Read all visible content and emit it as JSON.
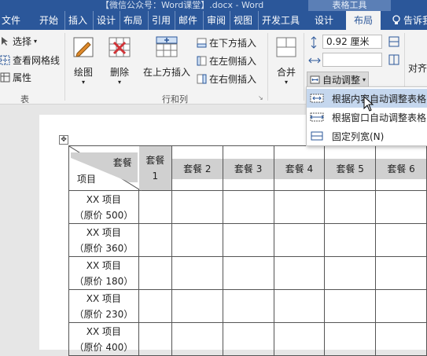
{
  "titlebar": {
    "document": "【微信公众号：Word课堂】.docx - Word",
    "table_tools": "表格工具"
  },
  "tabs": [
    "文件",
    "开始",
    "插入",
    "设计",
    "布局",
    "引用",
    "邮件",
    "审阅",
    "视图",
    "开发工具",
    "设计",
    "布局"
  ],
  "tell_me": "告诉我",
  "ribbon": {
    "select": "选择",
    "view_gridlines": "查看网格线",
    "properties": "属性",
    "group_table": "表",
    "draw": "绘图",
    "delete": "删除",
    "insert_above": "在上方插入",
    "insert_below": "在下方插入",
    "insert_left": "在左侧插入",
    "insert_right": "在右侧插入",
    "group_rows_cols": "行和列",
    "merge": "合并",
    "row_height": "0.92 厘米",
    "autofit": "自动调整",
    "align": "对齐"
  },
  "autofit_menu": [
    {
      "label": "根据内容自动调整表格(F)",
      "highlighted": true
    },
    {
      "label": "根据窗口自动调整表格(W)",
      "highlighted": false
    },
    {
      "label": "固定列宽(N)",
      "highlighted": false
    }
  ],
  "table": {
    "corner_top": "套餐",
    "corner_bottom": "项目",
    "header_first_top": "套餐",
    "header_first_bottom": "1",
    "headers": [
      "套餐 2",
      "套餐 3",
      "套餐 4",
      "套餐 5",
      "套餐 6"
    ],
    "rows": [
      {
        "name": "XX 项目",
        "price": "（原价 500）"
      },
      {
        "name": "XX 项目",
        "price": "（原价 360）"
      },
      {
        "name": "XX 项目",
        "price": "（原价 180）"
      },
      {
        "name": "XX 项目",
        "price": "（原价 230）"
      },
      {
        "name": "XX 项目",
        "price": "（原价 400）"
      }
    ]
  },
  "colors": {
    "brand": "#2b579a",
    "menu_highlight": "#c5d7ee",
    "header_fill": "#d0d0d0"
  }
}
